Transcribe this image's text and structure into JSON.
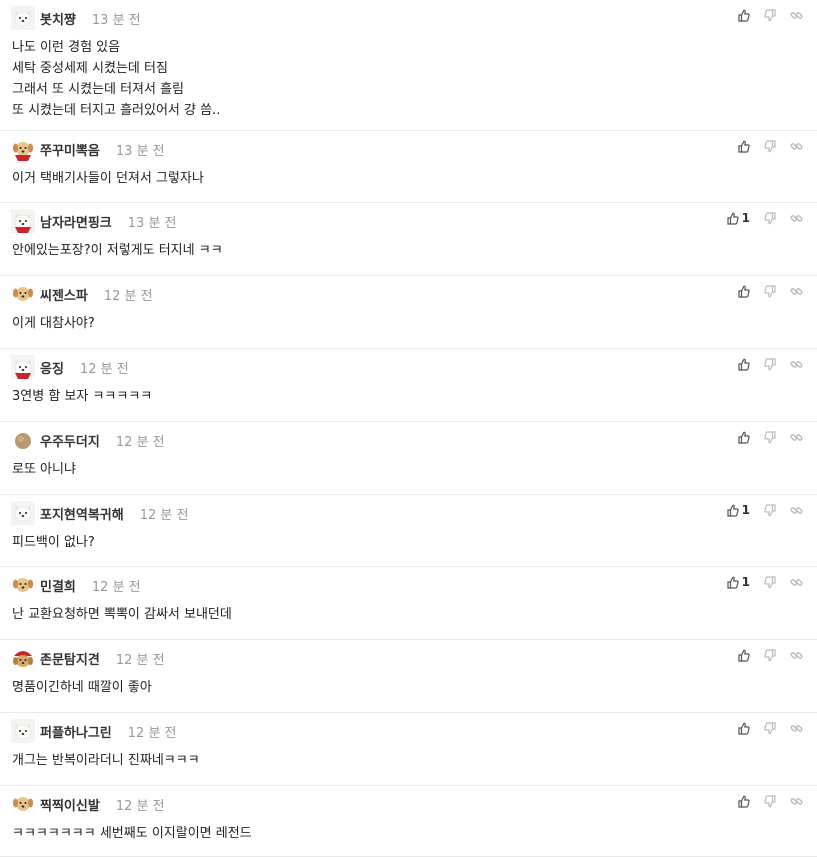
{
  "comments": [
    {
      "nick": "봇치쨩",
      "time": "13 분 전",
      "avatar": "white-dog",
      "likes": "",
      "lines": [
        "나도 이런 경험 있음",
        "세탁 중성세제 시켰는데 터짐",
        "그래서 또 시켰는데 터져서 흘림",
        "또 시켰는데 터지고 흘러있어서 걍 씀.."
      ]
    },
    {
      "nick": "쭈꾸미뽁음",
      "time": "13 분 전",
      "avatar": "puppy-red-cape",
      "likes": "",
      "lines": [
        "이거 택배기사들이 던져서 그렇자나"
      ]
    },
    {
      "nick": "남자라면핑크",
      "time": "13 분 전",
      "avatar": "white-dog-cape",
      "likes": "1",
      "lines": [
        "안에있는포장?이 저렇게도 터지네 ㅋㅋ"
      ]
    },
    {
      "nick": "씨젠스파",
      "time": "12 분 전",
      "avatar": "puppy",
      "likes": "",
      "lines": [
        "이게 대참사야?"
      ]
    },
    {
      "nick": "응징",
      "time": "12 분 전",
      "avatar": "white-dog-cape",
      "likes": "",
      "lines": [
        "3연병 함 보자 ㅋㅋㅋㅋㅋ"
      ]
    },
    {
      "nick": "우주두더지",
      "time": "12 분 전",
      "avatar": "dot",
      "likes": "",
      "lines": [
        "로또 아니냐"
      ]
    },
    {
      "nick": "포지현역복귀해",
      "time": "12 분 전",
      "avatar": "white-dog",
      "likes": "1",
      "lines": [
        "피드백이 없나?"
      ]
    },
    {
      "nick": "민결희",
      "time": "12 분 전",
      "avatar": "puppy",
      "likes": "1",
      "lines": [
        "난 교환요청하면 뽁뽁이 감싸서 보내던데"
      ]
    },
    {
      "nick": "존문탐지견",
      "time": "12 분 전",
      "avatar": "red-hat-dog",
      "likes": "",
      "lines": [
        "명품이긴하네 때깔이 좋아"
      ]
    },
    {
      "nick": "퍼플하나그린",
      "time": "12 분 전",
      "avatar": "white-dog",
      "likes": "",
      "lines": [
        "개그는 반복이라더니 진짜네ㅋㅋㅋ"
      ]
    },
    {
      "nick": "찍찍이신발",
      "time": "12 분 전",
      "avatar": "puppy",
      "likes": "",
      "lines": [
        "ㅋㅋㅋㅋㅋㅋㅋ 세번째도 이지랄이면 레전드"
      ]
    }
  ]
}
